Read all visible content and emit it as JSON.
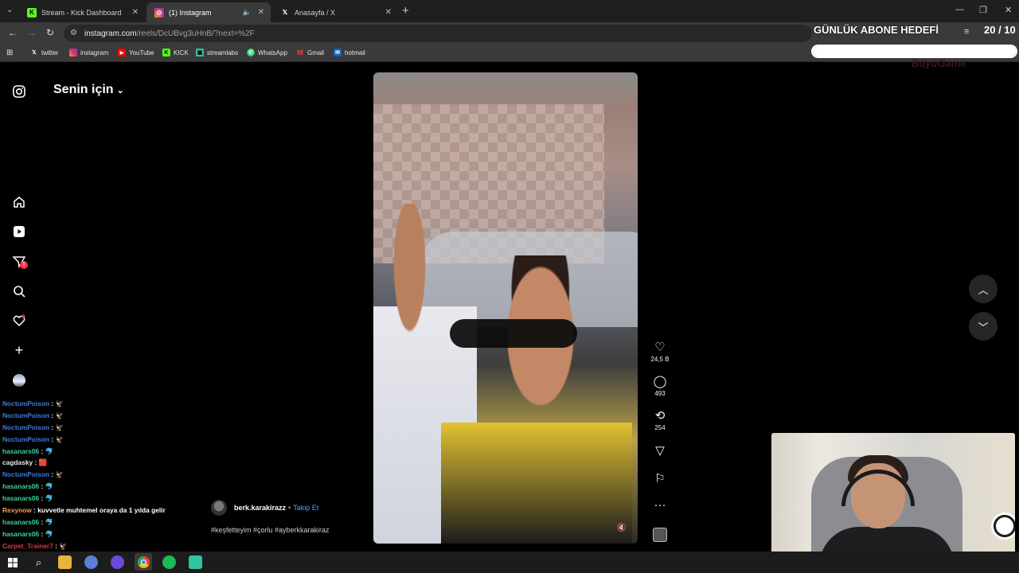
{
  "browser": {
    "tabs": [
      {
        "title": "Stream - Kick Dashboard",
        "icon": "kick-icon",
        "active": false
      },
      {
        "title": "(1) Instagram",
        "icon": "instagram-icon",
        "active": true
      },
      {
        "title": "Anasayfa / X",
        "icon": "x-icon",
        "active": false
      }
    ],
    "url_host": "instagram.com",
    "url_path": "/reels/DcUBvg3uHnB/?next=%2F",
    "bookmarks": [
      "twitter",
      "instagram",
      "YouTube",
      "KICK",
      "streamlabs",
      "WhatsApp",
      "Gmail",
      "hotmail"
    ]
  },
  "overlay": {
    "goal_title": "GÜNLÜK ABONE HEDEFİ",
    "goal_count": "20 / 10",
    "goal_progress": 1.0,
    "brand": "BüyüGame"
  },
  "instagram": {
    "feed_title": "Senin için",
    "sidebar_icons": [
      "instagram-logo-icon",
      "home-icon",
      "reels-icon",
      "messages-icon",
      "search-icon",
      "notifications-icon",
      "create-icon",
      "profile-avatar"
    ],
    "messages_badge": "1",
    "reel": {
      "author": "berk.karakirazz",
      "separator": "•",
      "follow_label": "Takip Et",
      "hashtags": "#keşfetteyim #çorlu #ayberkkarakiraz",
      "likes": "24,5 B",
      "comments": "493",
      "reposts": "254"
    }
  },
  "chat": [
    {
      "user": "NoctumPoison",
      "color": "#3c7bd9",
      "text": ":",
      "emote": "🦅"
    },
    {
      "user": "NoctumPoison",
      "color": "#3c7bd9",
      "text": ":",
      "emote": "🦅"
    },
    {
      "user": "NoctumPoison",
      "color": "#3c7bd9",
      "text": ":",
      "emote": "🦅"
    },
    {
      "user": "NoctumPoison",
      "color": "#3c7bd9",
      "text": ":",
      "emote": "🦅"
    },
    {
      "user": "hasanars06",
      "color": "#38d39f",
      "text": ":",
      "emote": "🐬"
    },
    {
      "user": "cagdasky",
      "color": "#e8e8e8",
      "text": ":",
      "emote": "🟥"
    },
    {
      "user": "NoctumPoison",
      "color": "#3c7bd9",
      "text": ":",
      "emote": "🦅"
    },
    {
      "user": "hasanars06",
      "color": "#38d39f",
      "text": ":",
      "emote": "🐬"
    },
    {
      "user": "hasanars06",
      "color": "#38d39f",
      "text": ":",
      "emote": "🐬"
    },
    {
      "user": "Rexynow",
      "color": "#f0a44a",
      "text": ": kuvvetle muhtemel oraya da 1 yılda gelir",
      "emote": ""
    },
    {
      "user": "hasanars06",
      "color": "#38d39f",
      "text": ":",
      "emote": "🐬"
    },
    {
      "user": "hasanars06",
      "color": "#38d39f",
      "text": ":",
      "emote": "🐬"
    },
    {
      "user": "Carpet_Trainer7",
      "color": "#d9364a",
      "text": ":",
      "emote": "🦅"
    }
  ]
}
